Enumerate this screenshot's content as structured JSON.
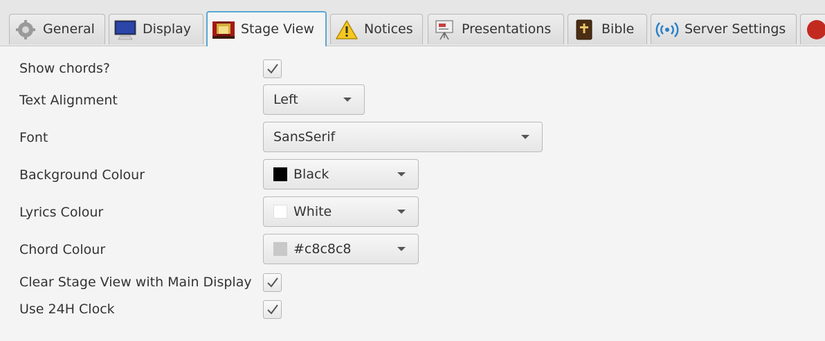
{
  "tabs": [
    {
      "label": "General",
      "icon": "gear-icon"
    },
    {
      "label": "Display",
      "icon": "monitor-icon"
    },
    {
      "label": "Stage View",
      "icon": "stage-icon",
      "active": true
    },
    {
      "label": "Notices",
      "icon": "warning-icon"
    },
    {
      "label": "Presentations",
      "icon": "projector-icon"
    },
    {
      "label": "Bible",
      "icon": "bible-icon"
    },
    {
      "label": "Server Settings",
      "icon": "wireless-icon"
    }
  ],
  "settings": {
    "show_chords": {
      "label": "Show chords?",
      "checked": true
    },
    "text_alignment": {
      "label": "Text Alignment",
      "value": "Left"
    },
    "font": {
      "label": "Font",
      "value": "SansSerif"
    },
    "background_colour": {
      "label": "Background Colour",
      "value": "Black",
      "swatch": "#000000"
    },
    "lyrics_colour": {
      "label": "Lyrics Colour",
      "value": "White",
      "swatch": "#ffffff"
    },
    "chord_colour": {
      "label": "Chord Colour",
      "value": "#c8c8c8",
      "swatch": "#c8c8c8"
    },
    "clear_stage_view": {
      "label": "Clear Stage View with Main Display",
      "checked": true
    },
    "use_24h_clock": {
      "label": "Use 24H Clock",
      "checked": true
    }
  },
  "colors": {
    "active_tab_border": "#5aa6d4"
  }
}
